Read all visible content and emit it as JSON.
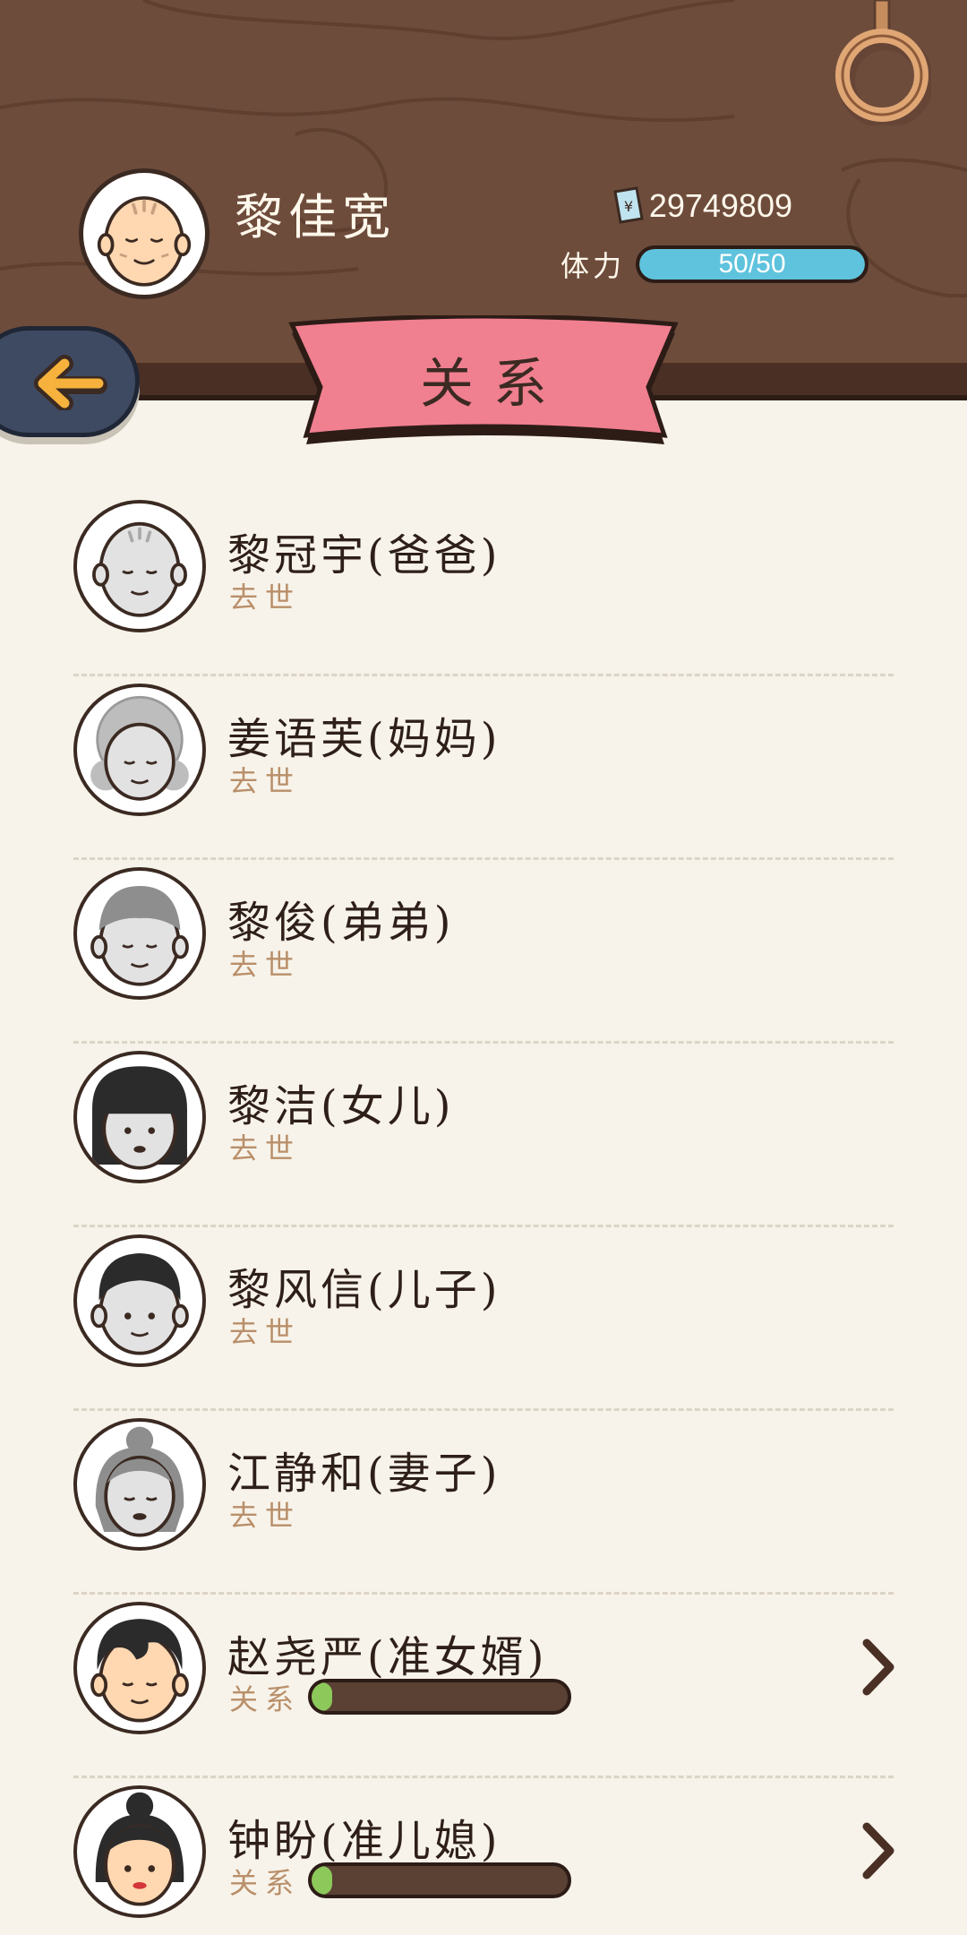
{
  "player": {
    "name": "黎佳宽",
    "money": "29749809",
    "stamina_label": "体力",
    "stamina_text": "50/50",
    "stamina_fraction": 1.0
  },
  "title": "关系",
  "colors": {
    "wood": "#6e4c3b",
    "ribbon": "#f07f90",
    "stamina": "#5fc3dd",
    "relation_fill": "#8dc85a",
    "background": "#f7f3ea"
  },
  "relations": [
    {
      "name": "黎冠宇(爸爸)",
      "status": "去世",
      "face": "old-man-bald",
      "deceased": true
    },
    {
      "name": "姜语芙(妈妈)",
      "status": "去世",
      "face": "old-woman-curly",
      "deceased": true
    },
    {
      "name": "黎俊(弟弟)",
      "status": "去世",
      "face": "old-man-hair",
      "deceased": true
    },
    {
      "name": "黎洁(女儿)",
      "status": "去世",
      "face": "woman-bob",
      "deceased": true
    },
    {
      "name": "黎风信(儿子)",
      "status": "去世",
      "face": "man-short-hair",
      "deceased": true
    },
    {
      "name": "江静和(妻子)",
      "status": "去世",
      "face": "old-woman-bun",
      "deceased": true
    },
    {
      "name": "赵尧严(准女婿)",
      "status": "关系",
      "face": "young-man",
      "deceased": false,
      "relation_level": 0.06
    },
    {
      "name": "钟盼(准儿媳)",
      "status": "关系",
      "face": "young-woman-bun",
      "deceased": false,
      "relation_level": 0.06
    }
  ]
}
